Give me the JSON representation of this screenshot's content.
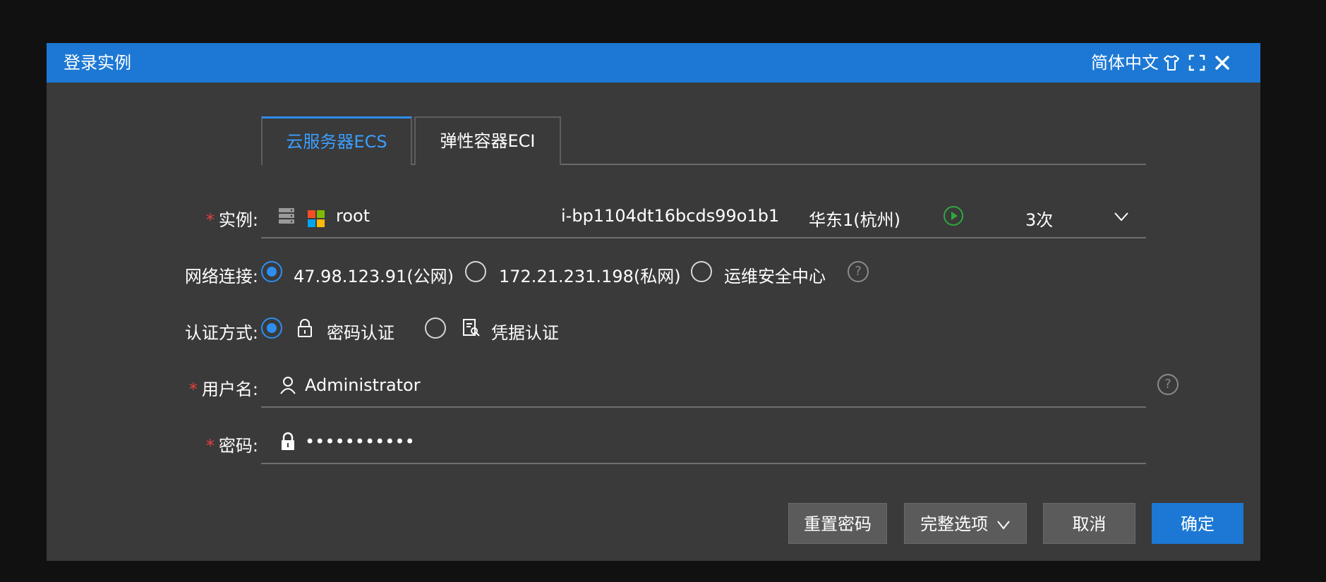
{
  "dialog": {
    "title": "登录实例",
    "language": "简体中文",
    "icons": [
      "shirt-icon",
      "expand-icon",
      "close-icon"
    ]
  },
  "tabs": [
    {
      "label": "云服务器ECS",
      "active": true
    },
    {
      "label": "弹性容器ECI",
      "active": false
    }
  ],
  "instance": {
    "label": "实例:",
    "name": "root",
    "id": "i-bp1104dt16bcds99o1b1",
    "region": "华东1(杭州)",
    "count": "3次",
    "icons": [
      "server-icon",
      "windows-icon",
      "play-circle-icon",
      "chevron-down-icon"
    ]
  },
  "network": {
    "label": "网络连接:",
    "options": [
      {
        "label": "47.98.123.91(公网)",
        "selected": true
      },
      {
        "label": "172.21.231.198(私网)",
        "selected": false
      },
      {
        "label": "运维安全中心",
        "selected": false
      }
    ],
    "help": "?"
  },
  "auth": {
    "label": "认证方式:",
    "options": [
      {
        "label": "密码认证",
        "selected": true,
        "icon": "lock-icon"
      },
      {
        "label": "凭据认证",
        "selected": false,
        "icon": "credential-icon"
      }
    ]
  },
  "username": {
    "label": "用户名:",
    "value": "Administrator",
    "help": "?"
  },
  "password": {
    "label": "密码:",
    "value": "•••••••••••"
  },
  "buttons": {
    "reset": "重置密码",
    "options": "完整选项",
    "cancel": "取消",
    "confirm": "确定"
  },
  "colors": {
    "titlebar": "#1c78d4",
    "background": "#3a3a3a",
    "accent": "#2d8ef0",
    "required": "#e34040"
  }
}
